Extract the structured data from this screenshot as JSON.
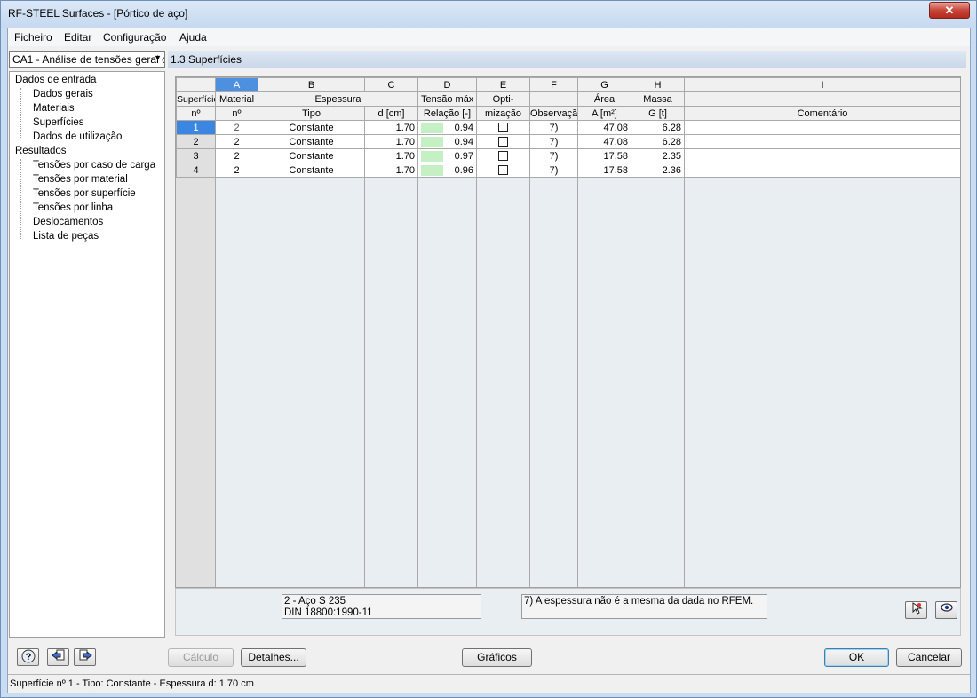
{
  "window": {
    "title": "RF-STEEL Surfaces - [Pórtico de aço]",
    "close_glyph": "✕"
  },
  "menu": {
    "file": "Ficheiro",
    "edit": "Editar",
    "settings": "Configuração",
    "help": "Ajuda"
  },
  "case_select": {
    "value": "CA1 - Análise de tensões geral c",
    "arrow": "▼"
  },
  "tree": {
    "input_group": "Dados de entrada",
    "input_items": [
      "Dados gerais",
      "Materiais",
      "Superfícies",
      "Dados de utilização"
    ],
    "results_group": "Resultados",
    "results_items": [
      "Tensões por caso de carga",
      "Tensões por material",
      "Tensões por superfície",
      "Tensões por linha",
      "Deslocamentos",
      "Lista de peças"
    ]
  },
  "section": {
    "title": "1.3 Superfícies"
  },
  "table": {
    "letters": [
      "A",
      "B",
      "C",
      "D",
      "E",
      "F",
      "G",
      "H",
      "I"
    ],
    "header1": {
      "surface": "Superfície",
      "material": "Material",
      "thickness": "Espessura",
      "stress": "Tensão máx",
      "optimization": "Opti-",
      "area": "Área",
      "mass": "Massa"
    },
    "header2": {
      "surface": "nº",
      "material": "nº",
      "type": "Tipo",
      "d": "d [cm]",
      "ratio": "Relação [-]",
      "optimization": "mização",
      "remark": "Observação",
      "area": "A [m²]",
      "mass": "G [t]",
      "comment": "Comentário"
    },
    "rows": [
      {
        "no": "1",
        "material": "2",
        "type": "Constante",
        "d": "1.70",
        "ratio": "0.94",
        "remark": "7)",
        "area": "47.08",
        "mass": "6.28",
        "comment": ""
      },
      {
        "no": "2",
        "material": "2",
        "type": "Constante",
        "d": "1.70",
        "ratio": "0.94",
        "remark": "7)",
        "area": "47.08",
        "mass": "6.28",
        "comment": ""
      },
      {
        "no": "3",
        "material": "2",
        "type": "Constante",
        "d": "1.70",
        "ratio": "0.97",
        "remark": "7)",
        "area": "17.58",
        "mass": "2.35",
        "comment": ""
      },
      {
        "no": "4",
        "material": "2",
        "type": "Constante",
        "d": "1.70",
        "ratio": "0.96",
        "remark": "7)",
        "area": "17.58",
        "mass": "2.36",
        "comment": ""
      }
    ]
  },
  "footer": {
    "material_line1": "2 - Aço S 235",
    "material_line2": "DIN 18800:1990-11",
    "note": "7) A espessura não é a mesma da dada no RFEM.",
    "pick_icon": "pick-cursor-icon",
    "view_icon": "eye-icon"
  },
  "buttons": {
    "calc": "Cálculo",
    "details": "Detalhes...",
    "graphics": "Gráficos",
    "ok": "OK",
    "cancel": "Cancelar"
  },
  "status": "Superfície nº 1  -  Tipo: Constante  -  Espessura d: 1.70 cm"
}
